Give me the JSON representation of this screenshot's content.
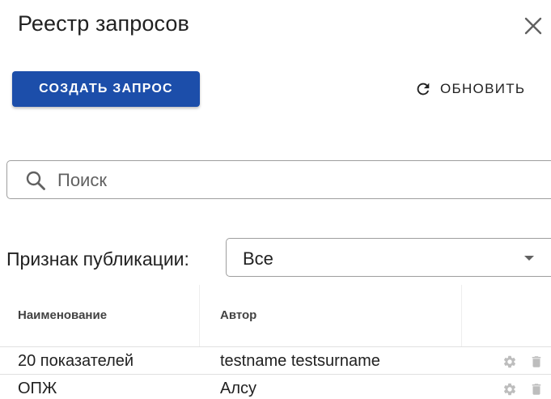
{
  "dialog": {
    "title": "Реестр запросов",
    "close_icon": "close-icon"
  },
  "toolbar": {
    "create_label": "СОЗДАТЬ ЗАПРОС",
    "refresh_label": "ОБНОВИТЬ",
    "refresh_icon": "refresh-icon"
  },
  "search": {
    "placeholder": "Поиск",
    "value": "",
    "icon": "search-icon"
  },
  "filter": {
    "label": "Признак публикации:",
    "selected": "Все",
    "icon": "chevron-down-icon"
  },
  "table": {
    "columns": [
      "Наименование",
      "Автор"
    ],
    "rows": [
      {
        "name": "20 показателей",
        "author": "testname testsurname",
        "actions": [
          "gear-icon",
          "trash-icon"
        ]
      },
      {
        "name": "ОПЖ",
        "author": "Алсу",
        "actions": [
          "gear-icon",
          "trash-icon"
        ]
      }
    ]
  },
  "colors": {
    "primary": "#1c4eaa",
    "icon_muted": "#bdbdbd",
    "border": "#9e9e9e"
  }
}
